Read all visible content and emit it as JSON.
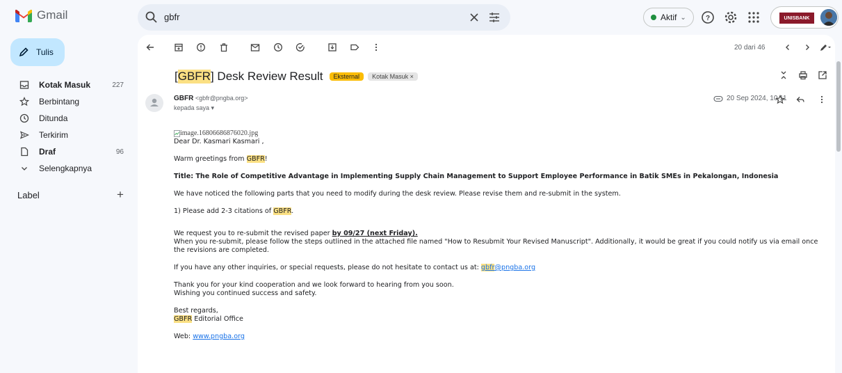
{
  "app": {
    "name": "Gmail"
  },
  "search": {
    "query": "gbfr"
  },
  "status": {
    "label": "Aktif"
  },
  "account": {
    "org": "UNISBANK"
  },
  "compose": {
    "label": "Tulis"
  },
  "nav": {
    "items": [
      {
        "label": "Kotak Masuk",
        "count": "227",
        "bold": true,
        "icon": "inbox-icon"
      },
      {
        "label": "Berbintang",
        "count": "",
        "bold": false,
        "icon": "star-icon"
      },
      {
        "label": "Ditunda",
        "count": "",
        "bold": false,
        "icon": "clock-icon"
      },
      {
        "label": "Terkirim",
        "count": "",
        "bold": false,
        "icon": "send-icon"
      },
      {
        "label": "Draf",
        "count": "96",
        "bold": true,
        "icon": "draft-icon"
      },
      {
        "label": "Selengkapnya",
        "count": "",
        "bold": false,
        "icon": "chevron-down-icon"
      }
    ],
    "label_header": "Label"
  },
  "toolbar": {
    "pager": "20 dari 46"
  },
  "email": {
    "subject_prefix": "[",
    "subject_hl": "GBFR",
    "subject_rest": "] Desk Review Result",
    "badge_external": "Eksternal",
    "badge_inbox": "Kotak Masuk ×",
    "sender_name": "GBFR",
    "sender_email": "<gbfr@pngba.org>",
    "to": "kepada saya ▾",
    "date": "20 Sep 2024, 10.11",
    "image_alt": "image.16806686876020.jpg",
    "greeting": "Dear Dr. Kasmari Kasmari ,",
    "warm_pre": "Warm greetings from ",
    "warm_hl": "GBFR",
    "warm_post": "!",
    "title": "Title: The Role of Competitive Advantage in Implementing Supply Chain Management to Support Employee Performance in Batik SMEs in Pekalongan, Indonesia",
    "notice": "We have noticed the following parts that you need to modify during the desk review. Please revise them and re-submit in the system.",
    "item1_pre": "1) Please add 2-3 citations of ",
    "item1_hl": "GBFR",
    "item1_post": ".",
    "request_pre": "We request you to re-submit the revised paper ",
    "request_bold": "by 09/27 (next Friday).",
    "resubmit": "When you re-submit, please follow the steps outlined in the attached file named \"How to Resubmit Your Revised Manuscript\". Additionally, it would be great if you could notify us via email once the revisions are completed.",
    "inquiries_pre": "If you have any other inquiries, or special requests, please do not hesitate to contact us at: ",
    "contact_hl": "gbfr",
    "contact_rest": "@pngba.org",
    "thanks1": "Thank you for your kind cooperation and we look forward to hearing from you soon.",
    "thanks2": "Wishing you continued success and safety.",
    "regards": "Best regards,",
    "office_hl": "GBFR",
    "office_rest": " Editorial Office",
    "web_label": "Web: ",
    "web_link": "www.pngba.org"
  }
}
